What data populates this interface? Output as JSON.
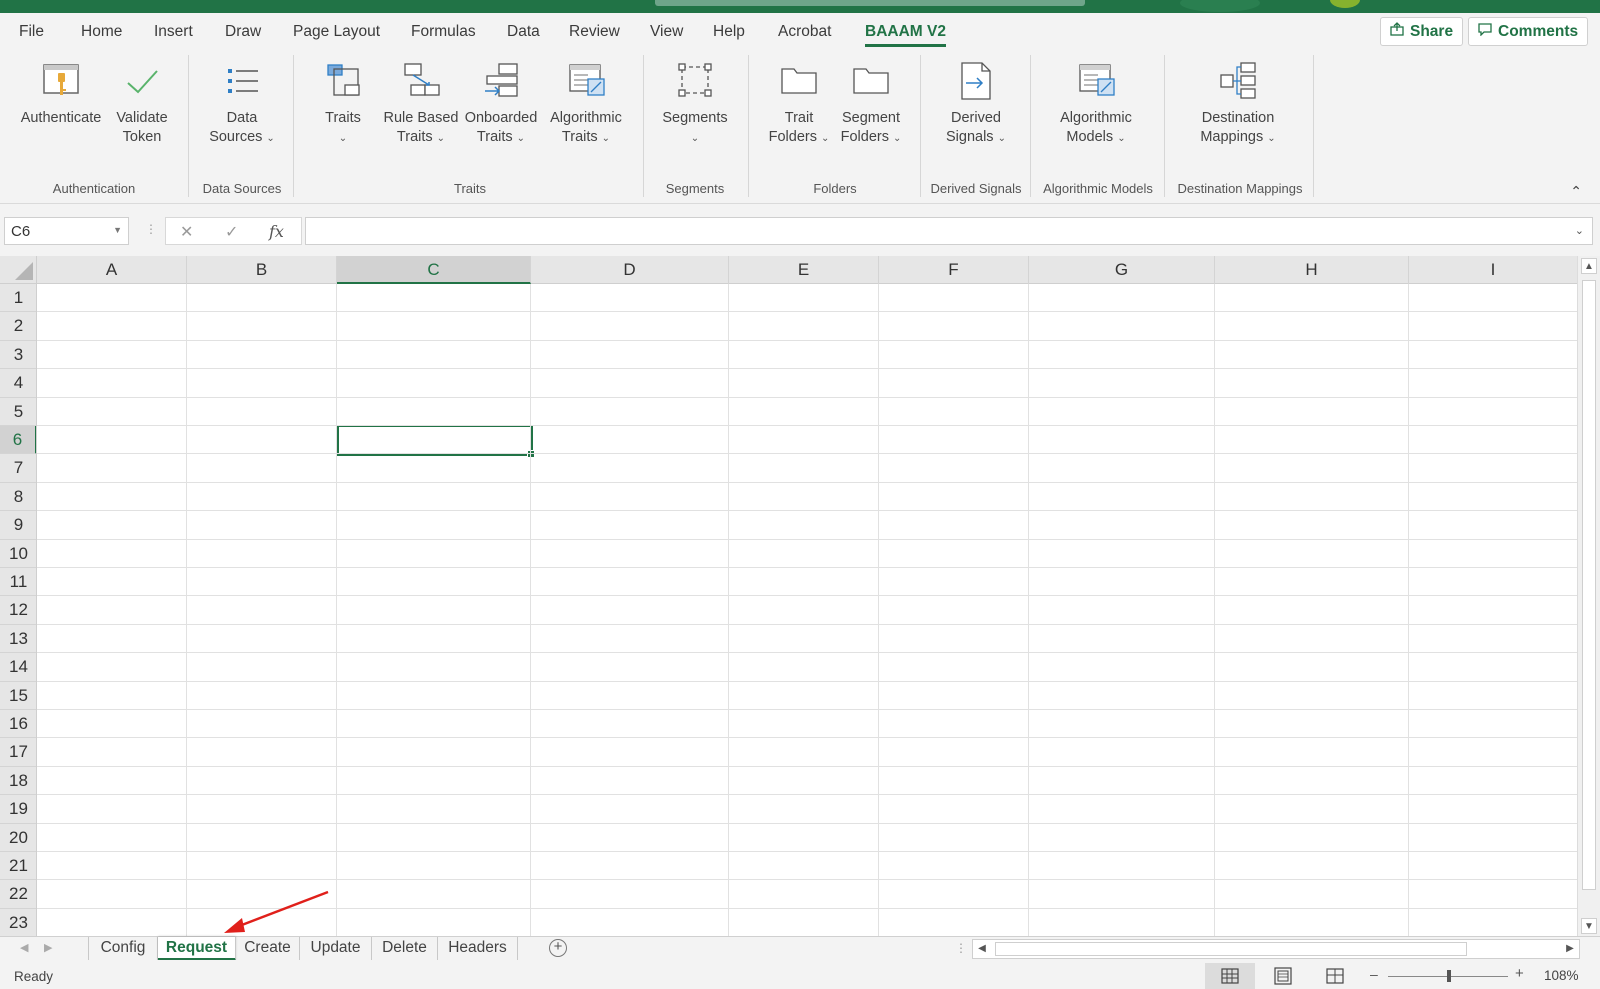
{
  "menu": {
    "tabs": [
      "File",
      "Home",
      "Insert",
      "Draw",
      "Page Layout",
      "Formulas",
      "Data",
      "Review",
      "View",
      "Help",
      "Acrobat",
      "BAAAM V2"
    ],
    "active_tab": "BAAAM V2",
    "share_label": "Share",
    "comments_label": "Comments"
  },
  "ribbon": {
    "buttons": {
      "authenticate": [
        "Authenticate",
        ""
      ],
      "validate_token": [
        "Validate",
        "Token"
      ],
      "data_sources": [
        "Data",
        "Sources"
      ],
      "traits": [
        "Traits",
        ""
      ],
      "rule_based_traits": [
        "Rule Based",
        "Traits"
      ],
      "onboarded_traits": [
        "Onboarded",
        "Traits"
      ],
      "algorithmic_traits": [
        "Algorithmic",
        "Traits"
      ],
      "segments": [
        "Segments",
        ""
      ],
      "trait_folders": [
        "Trait",
        "Folders"
      ],
      "segment_folders": [
        "Segment",
        "Folders"
      ],
      "derived_signals": [
        "Derived",
        "Signals"
      ],
      "algorithmic_models": [
        "Algorithmic",
        "Models"
      ],
      "destination_mappings": [
        "Destination",
        "Mappings"
      ]
    },
    "groups": {
      "authentication": "Authentication",
      "data_sources": "Data Sources",
      "traits": "Traits",
      "segments": "Segments",
      "folders": "Folders",
      "derived_signals": "Derived Signals",
      "algorithmic_models": "Algorithmic Models",
      "destination_mappings": "Destination Mappings"
    }
  },
  "formula_bar": {
    "name_box": "C6",
    "cancel_icon": "close-icon",
    "enter_icon": "check-icon",
    "function_label": "fx",
    "formula": ""
  },
  "grid": {
    "columns": [
      "A",
      "B",
      "C",
      "D",
      "E",
      "F",
      "G",
      "H",
      "I"
    ],
    "rows": [
      "1",
      "2",
      "3",
      "4",
      "5",
      "6",
      "7",
      "8",
      "9",
      "10",
      "11",
      "12",
      "13",
      "14",
      "15",
      "16",
      "17",
      "18",
      "19",
      "20",
      "21",
      "22",
      "23"
    ],
    "active_cell": "C6",
    "active_column": "C",
    "active_row": "6"
  },
  "sheets": {
    "tabs": [
      "Config",
      "Request",
      "Create",
      "Update",
      "Delete",
      "Headers"
    ],
    "active": "Request"
  },
  "status": {
    "text": "Ready",
    "zoom": "108%"
  },
  "colors": {
    "brand_green": "#217346",
    "annotation_red": "#e0201b"
  }
}
